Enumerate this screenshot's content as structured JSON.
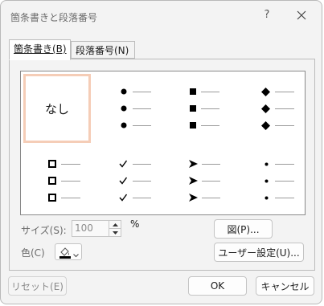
{
  "window": {
    "title": "箇条書きと段落番号",
    "help_label": "?"
  },
  "tabs": [
    {
      "label": "箇条書き(B)",
      "active": true
    },
    {
      "label": "段落番号(N)",
      "active": false
    }
  ],
  "gallery": {
    "none_label": "なし",
    "bullets": [
      "none",
      "filled-circle",
      "filled-square",
      "filled-diamond",
      "hollow-square",
      "checkmark",
      "arrowhead",
      "small-dot"
    ]
  },
  "size": {
    "label": "サイズ(S):",
    "value": "100",
    "unit": "%"
  },
  "color": {
    "label": "色(C)",
    "swatch": "#000000"
  },
  "buttons": {
    "picture": "図(P)...",
    "custom": "ユーザー設定(U)...",
    "reset": "リセット(E)",
    "ok": "OK",
    "cancel": "キャンセル"
  },
  "colors": {
    "selection_border": "#f5cdb7",
    "dialog_bg": "#f3f3f3"
  }
}
